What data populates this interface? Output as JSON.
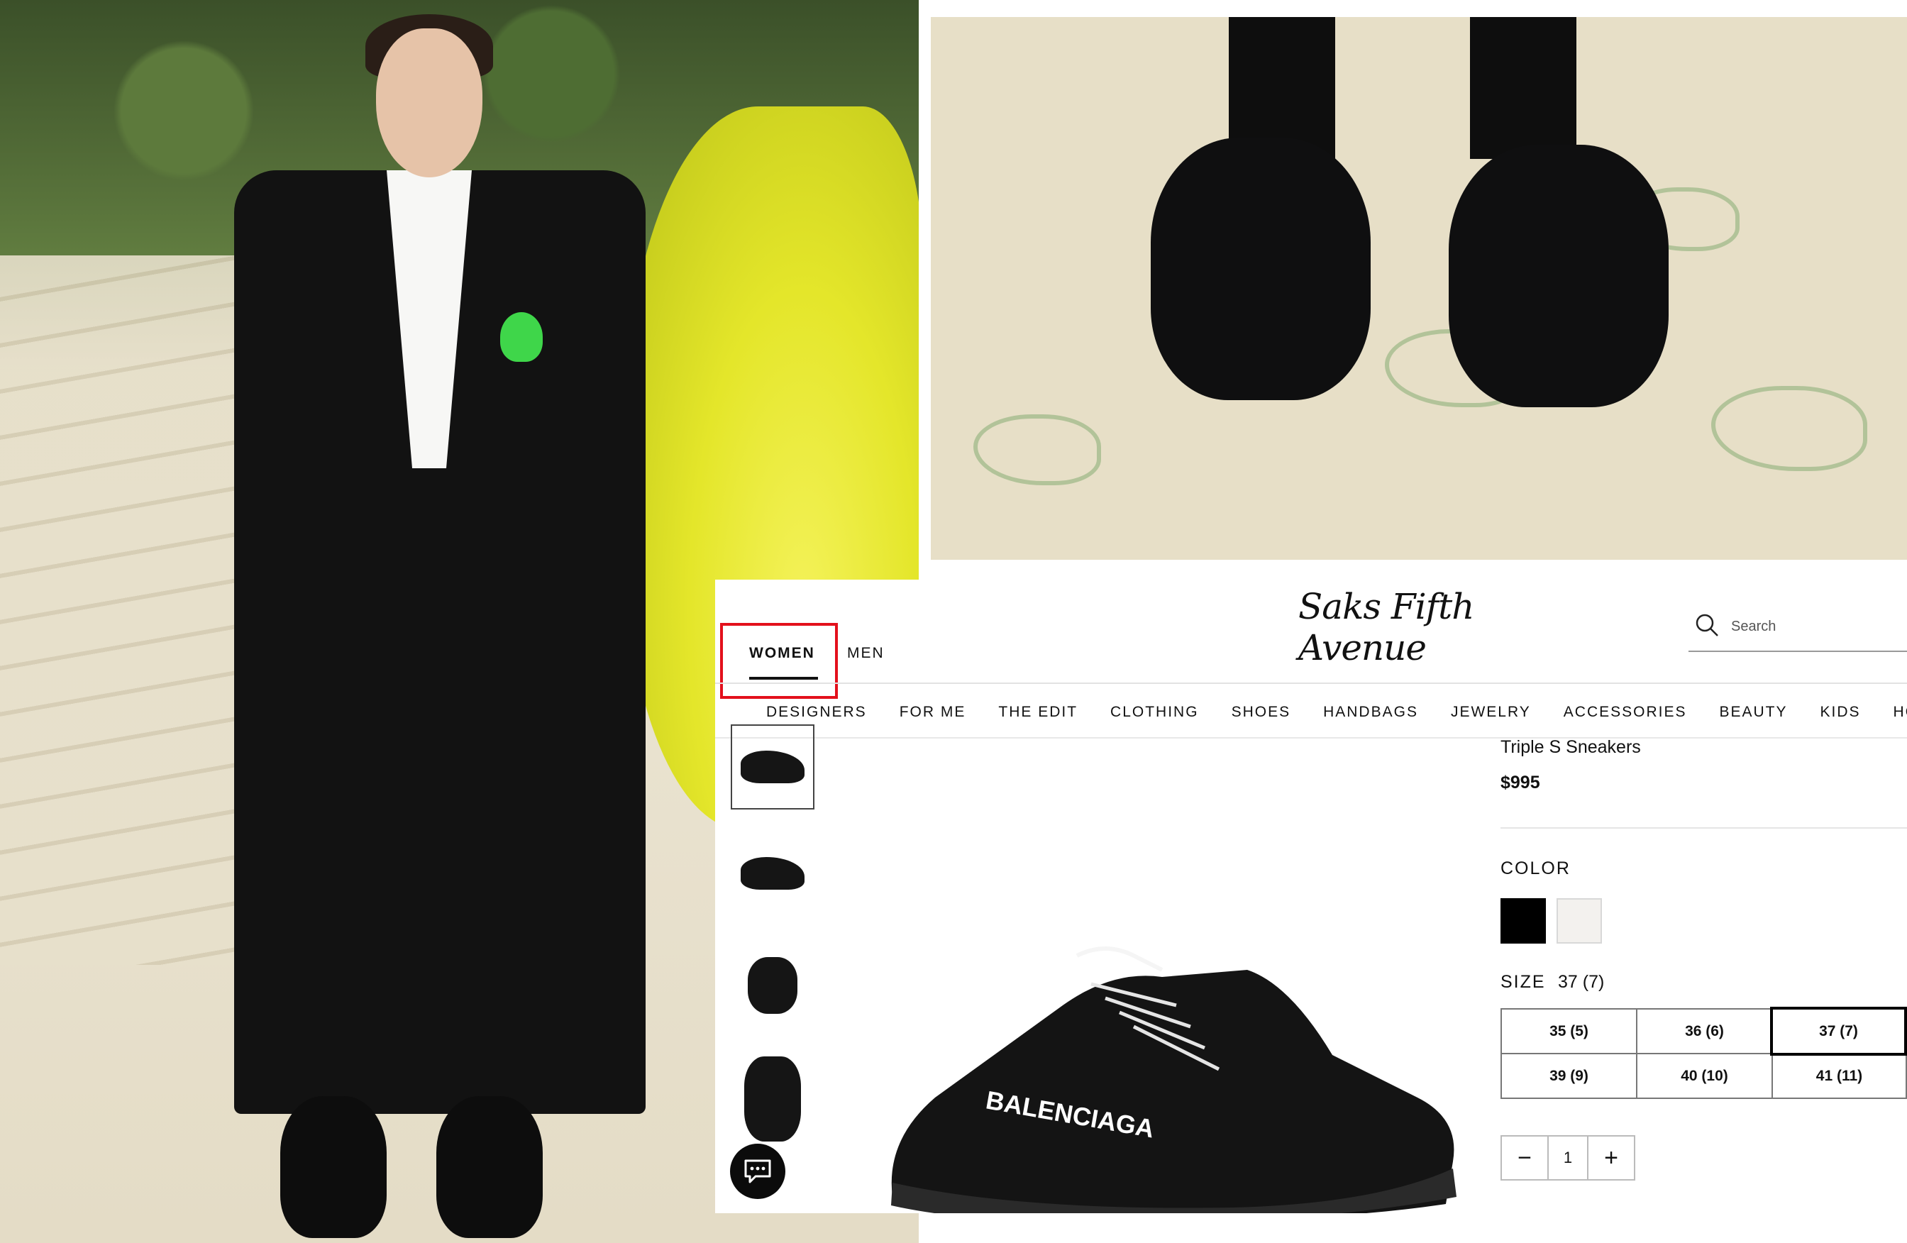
{
  "saks": {
    "logo_text": "Saks Fifth Avenue",
    "gender_tabs": [
      "WOMEN",
      "MEN"
    ],
    "search": {
      "placeholder": "Search"
    },
    "categories": [
      "DESIGNERS",
      "FOR ME",
      "THE EDIT",
      "CLOTHING",
      "SHOES",
      "HANDBAGS",
      "JEWELRY",
      "ACCESSORIES",
      "BEAUTY",
      "KIDS",
      "HOME"
    ],
    "product": {
      "name": "Triple S Sneakers",
      "price": "$995",
      "hero_brand_text": "BALENCIAGA"
    },
    "color": {
      "label": "COLOR",
      "swatches": [
        {
          "name": "black",
          "hex": "#000000"
        },
        {
          "name": "white",
          "hex": "#f3f1ee"
        }
      ]
    },
    "size": {
      "label": "SIZE",
      "selected": "37 (7)",
      "options": [
        "35 (5)",
        "36 (6)",
        "37 (7)",
        "39 (9)",
        "40 (10)",
        "41 (11)"
      ]
    },
    "quantity": {
      "value": "1",
      "minus": "−",
      "plus": "+"
    }
  },
  "colors": {
    "highlight": "#e3101c",
    "accent": "#000000"
  },
  "icons": [
    "search-icon",
    "chat-icon",
    "minus-icon",
    "plus-icon"
  ]
}
